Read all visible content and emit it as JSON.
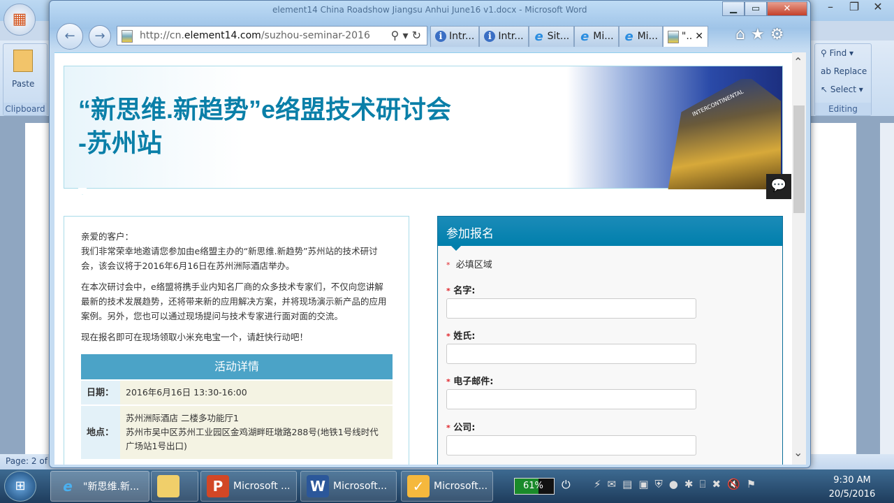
{
  "word": {
    "title": "element14 China Roadshow Jiangsu Anhui June16 v1.docx - Microsoft Word",
    "clipboard": {
      "paste_label": "Paste",
      "group_label": "Clipboard"
    },
    "editing": {
      "find": "Find",
      "replace": "Replace",
      "select": "Select",
      "group_label": "Editing"
    },
    "status": "Page: 2 of"
  },
  "ie": {
    "address": {
      "prefix": "http://cn.",
      "domain": "element14.com",
      "path": "/suzhou-seminar-2016"
    },
    "tabs": [
      {
        "label": "Intr...",
        "icon": "info-icon"
      },
      {
        "label": "Intr...",
        "icon": "info-icon"
      },
      {
        "label": "Sit...",
        "icon": "ie-icon"
      },
      {
        "label": "Mi...",
        "icon": "ie-icon"
      },
      {
        "label": "Mi...",
        "icon": "ie-icon"
      },
      {
        "label": "\"..",
        "icon": "page-icon",
        "active": true
      }
    ]
  },
  "page": {
    "banner_title_line1": "“新思维.新趋势”e络盟技术研讨会",
    "banner_title_line2": "-苏州站",
    "hotel_sign": "INTERCONTINENTAL",
    "intro": {
      "greeting": "亲爱的客户：",
      "p1": "我们非常荣幸地邀请您参加由e络盟主办的“新思维.新趋势”苏州站的技术研讨会，该会议将于2016年6月16日在苏州洲际酒店举办。",
      "p2": "在本次研讨会中，e络盟将携手业内知名厂商的众多技术专家们，不仅向您讲解最新的技术发展趋势，还将带来新的应用解决方案，并将现场演示新产品的应用案例。另外，您也可以通过现场提问与技术专家进行面对面的交流。",
      "p3": "现在报名即可在现场领取小米充电宝一个，请赶快行动吧！"
    },
    "details": {
      "title": "活动详情",
      "date_label": "日期：",
      "date_value": "2016年6月16日 13:30-16:00",
      "location_label": "地点：",
      "location_line1": "苏州洲际酒店 二楼多功能厅1",
      "location_line2": "苏州市吴中区苏州工业园区金鸡湖畔旺墩路288号(地铁1号线时代广场站1号出口)"
    },
    "form": {
      "title": "参加报名",
      "required_mark": "*",
      "required_note": "必填区域",
      "fields": [
        {
          "label": "名字:",
          "value": ""
        },
        {
          "label": "姓氏:",
          "value": ""
        },
        {
          "label": "电子邮件:",
          "value": ""
        },
        {
          "label": "公司:",
          "value": ""
        }
      ]
    }
  },
  "taskbar": {
    "items": [
      {
        "label": "\"新思维.新...",
        "icon": "ie-icon"
      },
      {
        "label": "",
        "icon": "folder-icon"
      },
      {
        "label": "Microsoft ...",
        "icon": "powerpoint-icon"
      },
      {
        "label": "Microsoft...",
        "icon": "word-icon"
      },
      {
        "label": "Microsoft...",
        "icon": "outlook-icon"
      }
    ],
    "battery": "61%",
    "battery_level": 61,
    "time": "9:30 AM",
    "date": "20/5/2016"
  },
  "colors": {
    "brand": "#0a7fa8",
    "details_header": "#4ba3c7",
    "required": "#e0242a"
  }
}
